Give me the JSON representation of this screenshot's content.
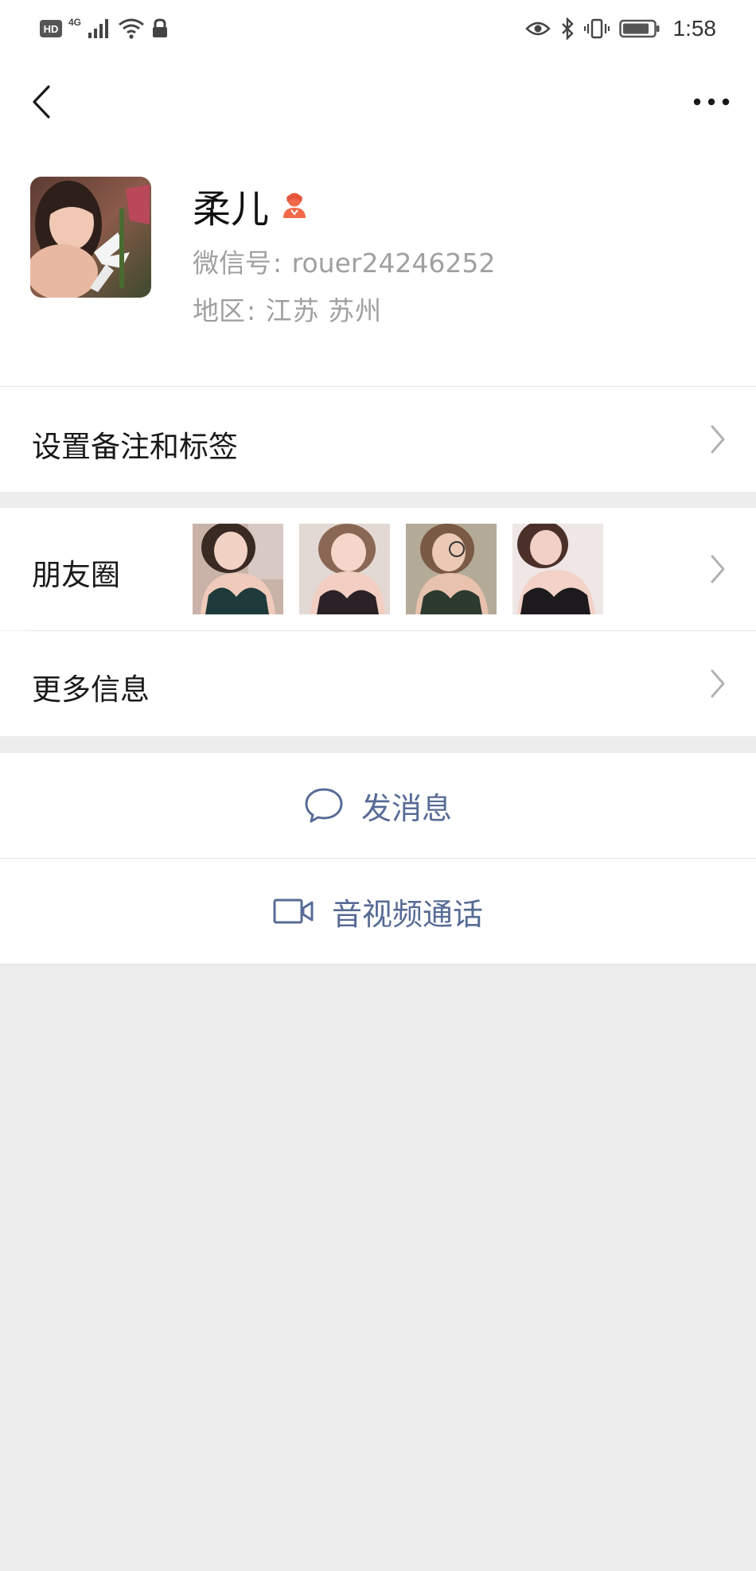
{
  "status_bar": {
    "hd": "HD",
    "network": "4G",
    "time": "1:58",
    "icons_left": [
      "hd-badge",
      "signal-icon",
      "wifi-icon",
      "lock-icon"
    ],
    "icons_right": [
      "eye-icon",
      "bluetooth-icon",
      "vibrate-icon",
      "battery-icon"
    ]
  },
  "nav": {
    "back_icon": "chevron-left-icon",
    "more_icon": "more-dots-icon"
  },
  "profile": {
    "name": "柔儿",
    "gender_icon": "female-icon",
    "gender_color": "#f06a4a",
    "wechat_id_label": "微信号",
    "wechat_id": "rouer24246252",
    "region_label": "地区",
    "region_province": "江苏",
    "region_city": "苏州"
  },
  "cells": {
    "remark_label": "设置备注和标签",
    "moments_label": "朋友圈",
    "moments_photo_count": 4,
    "more_info_label": "更多信息"
  },
  "actions": {
    "message_label": "发消息",
    "message_icon": "chat-bubble-icon",
    "call_label": "音视频通话",
    "call_icon": "video-camera-icon",
    "accent_color": "#576b95"
  },
  "colors": {
    "background": "#ededed",
    "card": "#ffffff",
    "secondary_text": "#a0a0a0"
  }
}
